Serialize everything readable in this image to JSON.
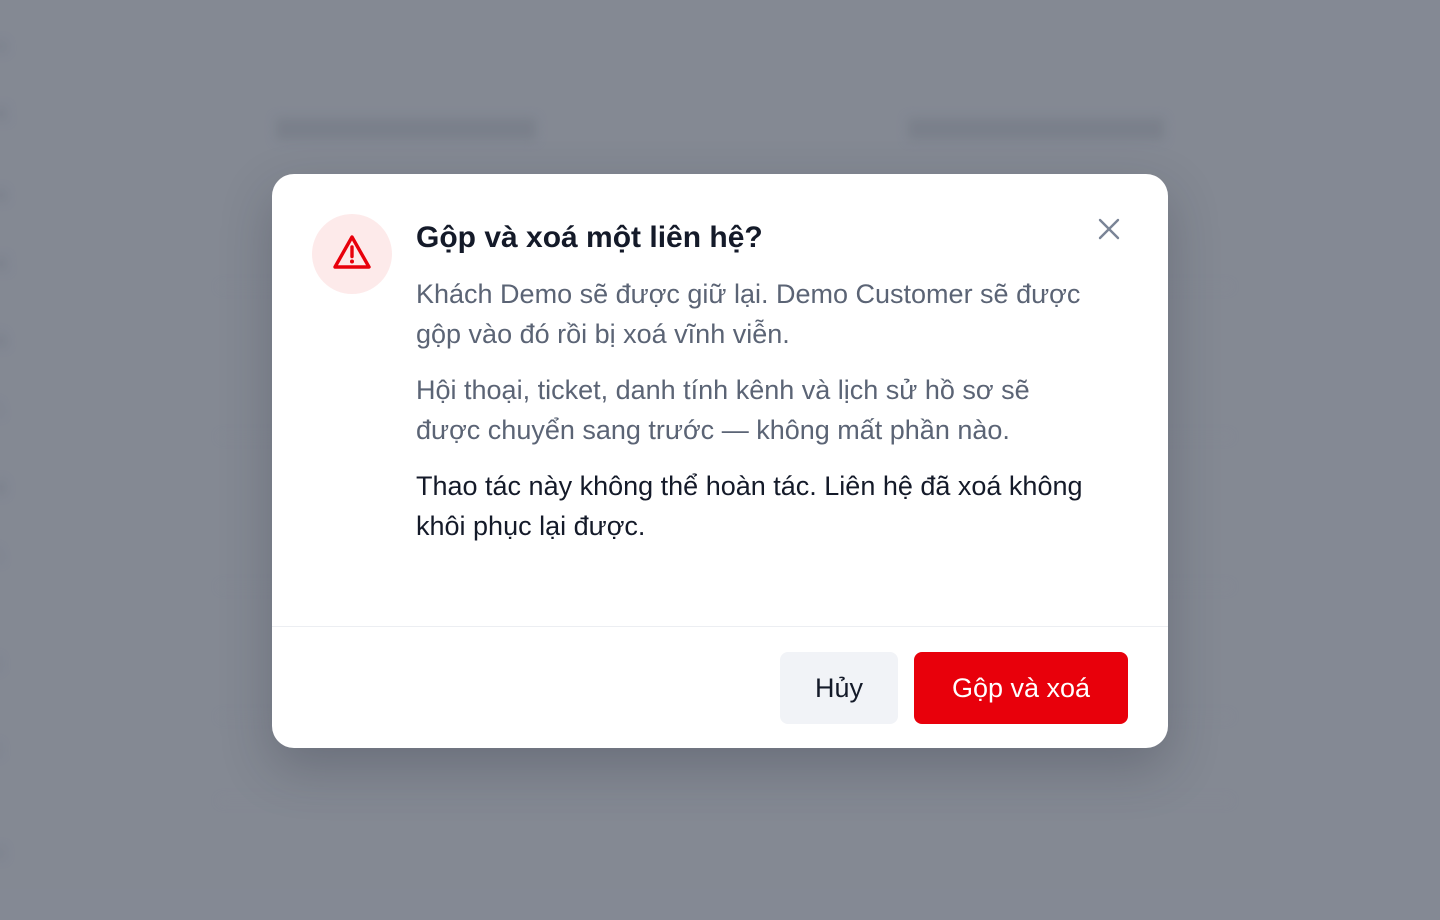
{
  "dialog": {
    "title": "Gộp và xoá một liên hệ?",
    "paragraph_1": "Khách Demo sẽ được giữ lại. Demo Customer sẽ được gộp vào đó rồi bị xoá vĩnh viễn.",
    "paragraph_2": "Hội thoại, ticket, danh tính kênh và lịch sử hồ sơ sẽ được chuyển sang trước — không mất phần nào.",
    "warning_text": "Thao tác này không thể hoàn tác. Liên hệ đã xoá không khôi phục lại được.",
    "cancel_label": "Hủy",
    "confirm_label": "Gộp và xoá",
    "icons": {
      "warning": "warning-triangle-icon",
      "close": "close-icon"
    }
  },
  "colors": {
    "danger": "#e8000b",
    "warning_bg": "#fdeaea",
    "title": "#141a29",
    "body": "#5b6475",
    "cancel_bg": "#f1f3f7"
  }
}
